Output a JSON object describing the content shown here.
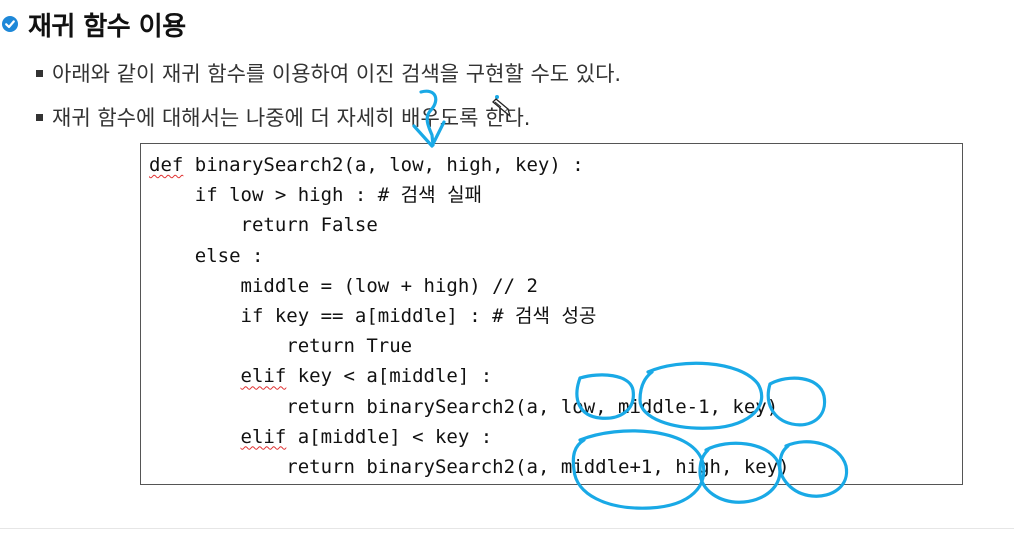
{
  "slide": {
    "title": "재귀 함수 이용",
    "bullets": [
      "아래와 같이 재귀 함수를 이용하여 이진 검색을 구현할 수도 있다.",
      "재귀 함수에 대해서는 나중에 더 자세히 배우도록 한다."
    ]
  },
  "code": {
    "lines": [
      {
        "indent": "",
        "kw": "def",
        "rest": " binarySearch2(a, low, high, key) :"
      },
      {
        "indent": "    ",
        "kw": "",
        "rest": "if low > high : # 검색 실패"
      },
      {
        "indent": "        ",
        "kw": "",
        "rest": "return False"
      },
      {
        "indent": "    ",
        "kw": "",
        "rest": "else :"
      },
      {
        "indent": "        ",
        "kw": "",
        "rest": "middle = (low + high) // 2"
      },
      {
        "indent": "        ",
        "kw": "",
        "rest": "if key == a[middle] : # 검색 성공"
      },
      {
        "indent": "            ",
        "kw": "",
        "rest": "return True"
      },
      {
        "indent": "        ",
        "kw": "elif",
        "rest": " key < a[middle] :"
      },
      {
        "indent": "            ",
        "kw": "",
        "rest": "return binarySearch2(a, low, middle-1, key)"
      },
      {
        "indent": "        ",
        "kw": "elif",
        "rest": " a[middle] < key :"
      },
      {
        "indent": "            ",
        "kw": "",
        "rest": "return binarySearch2(a, middle+1, high, key)"
      }
    ]
  },
  "colors": {
    "accent": "#1e88d8",
    "ink": "#19a9e6",
    "spell_underline": "#e03030"
  },
  "icons": [
    "check-circle-icon",
    "pen-cursor-icon"
  ]
}
